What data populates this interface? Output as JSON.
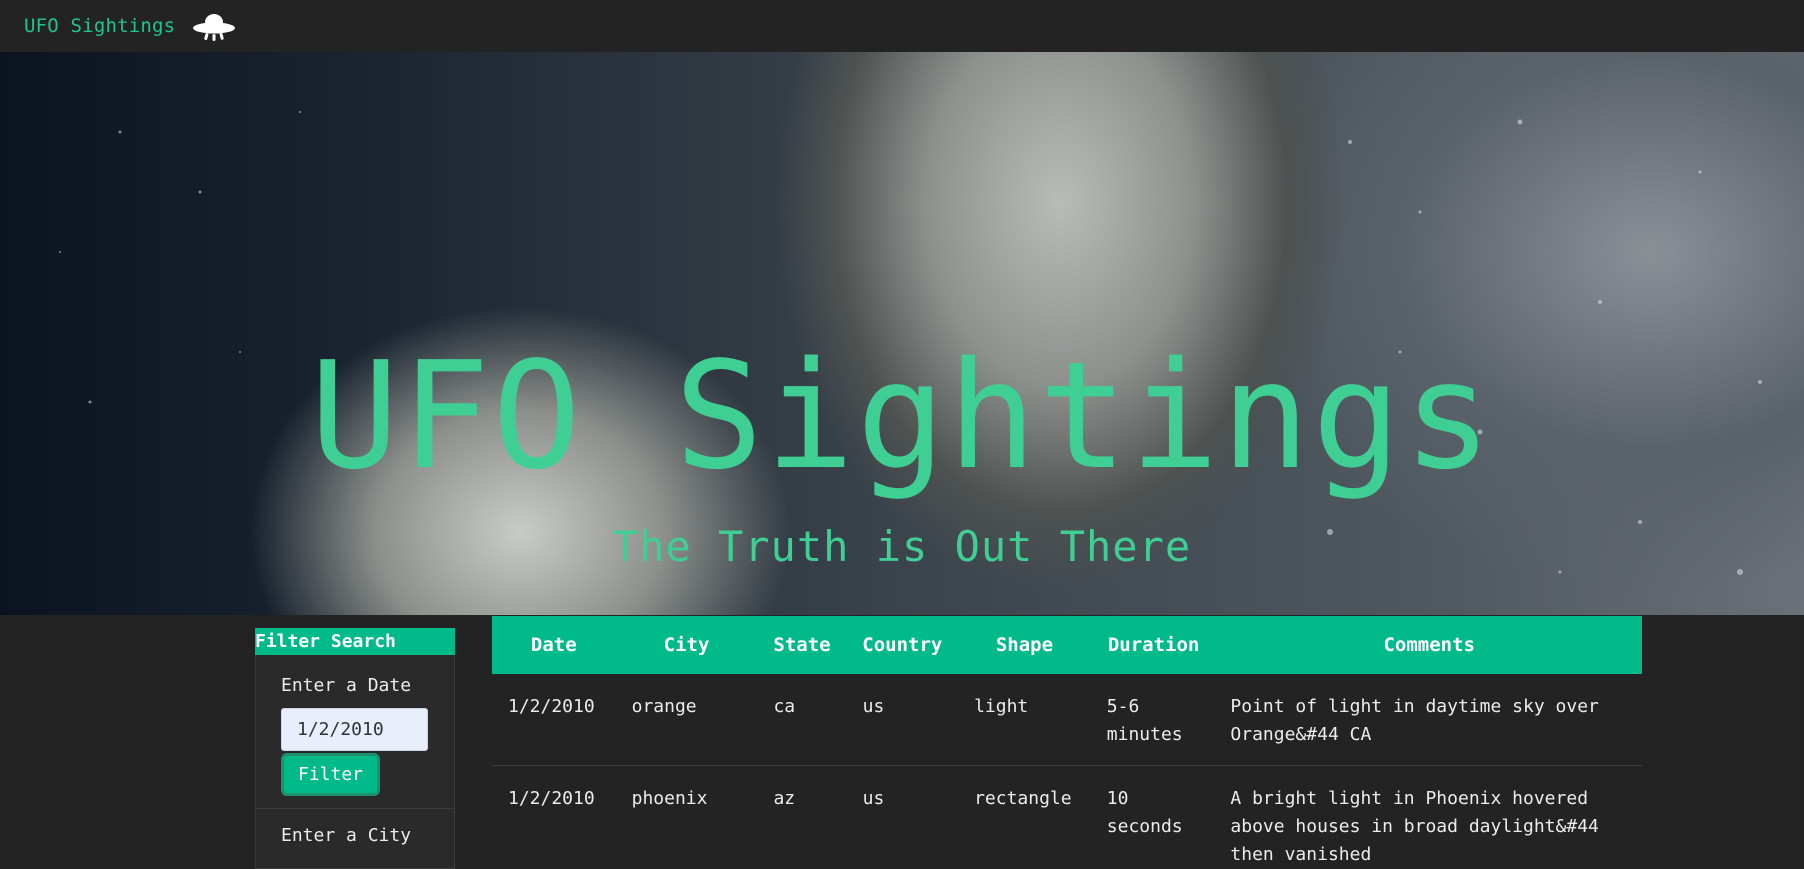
{
  "navbar": {
    "brand": "UFO Sightings",
    "icon": "ufo-icon"
  },
  "hero": {
    "title": "UFO Sightings",
    "subtitle": "The Truth is Out There"
  },
  "filter": {
    "header": "Filter Search",
    "date_label": "Enter a Date",
    "date_value": "1/2/2010",
    "filter_button": "Filter",
    "city_label": "Enter a City"
  },
  "table": {
    "headers": [
      "Date",
      "City",
      "State",
      "Country",
      "Shape",
      "Duration",
      "Comments"
    ],
    "rows": [
      {
        "date": "1/2/2010",
        "city": "orange",
        "state": "ca",
        "country": "us",
        "shape": "light",
        "duration": "5-6 minutes",
        "comments": "Point of light in daytime sky over Orange&#44 CA"
      },
      {
        "date": "1/2/2010",
        "city": "phoenix",
        "state": "az",
        "country": "us",
        "shape": "rectangle",
        "duration": "10 seconds",
        "comments": "A bright light in Phoenix hovered above houses in broad daylight&#44 then vanished"
      }
    ]
  },
  "colors": {
    "accent": "#00ba8a",
    "hero_text": "#3fcf94",
    "background": "#232323"
  }
}
